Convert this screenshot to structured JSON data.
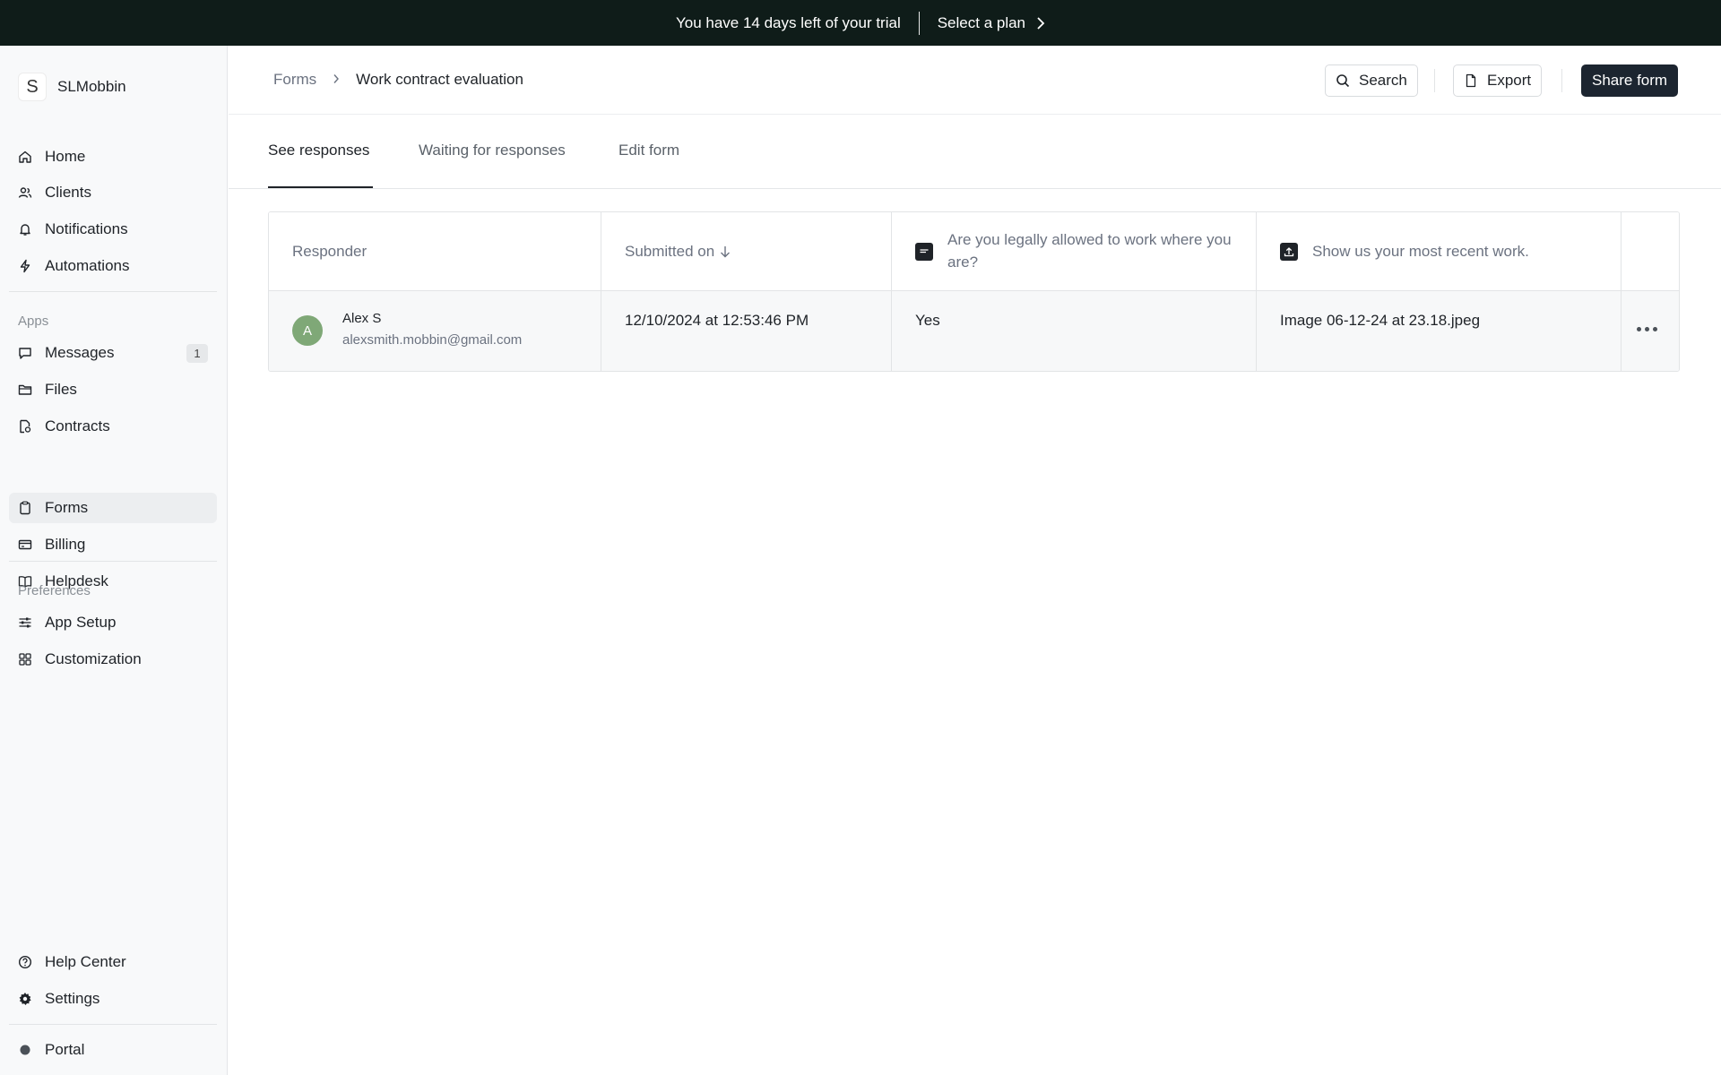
{
  "banner": {
    "trial_text": "You have 14 days left of your trial",
    "cta_label": "Select a plan"
  },
  "sidebar": {
    "brand_initial": "S",
    "brand_name": "SLMobbin",
    "main_items": [
      {
        "label": "Home",
        "icon": "home-icon"
      },
      {
        "label": "Clients",
        "icon": "users-icon"
      },
      {
        "label": "Notifications",
        "icon": "bell-icon"
      },
      {
        "label": "Automations",
        "icon": "bolt-icon"
      }
    ],
    "apps_heading": "Apps",
    "apps_items": [
      {
        "label": "Messages",
        "icon": "message-icon",
        "badge": "1"
      },
      {
        "label": "Files",
        "icon": "folder-icon"
      },
      {
        "label": "Contracts",
        "icon": "contract-icon"
      },
      {
        "label": "Forms",
        "icon": "clipboard-icon",
        "active": true
      },
      {
        "label": "Billing",
        "icon": "credit-card-icon"
      },
      {
        "label": "Helpdesk",
        "icon": "book-icon"
      }
    ],
    "preferences_heading": "Preferences",
    "preferences_items": [
      {
        "label": "App Setup",
        "icon": "sliders-icon"
      },
      {
        "label": "Customization",
        "icon": "grid-icon"
      }
    ],
    "footer_items": [
      {
        "label": "Help Center",
        "icon": "help-icon"
      },
      {
        "label": "Settings",
        "icon": "gear-icon"
      }
    ],
    "portal_label": "Portal"
  },
  "header": {
    "breadcrumb_root": "Forms",
    "breadcrumb_current": "Work contract evaluation",
    "search_label": "Search",
    "export_label": "Export",
    "share_label": "Share form"
  },
  "tabs": [
    {
      "label": "See responses",
      "active": true
    },
    {
      "label": "Waiting for responses"
    },
    {
      "label": "Edit form"
    }
  ],
  "table": {
    "columns": {
      "responder": "Responder",
      "submitted_on": "Submitted on",
      "question_1": "Are you legally allowed to work where you are?",
      "question_2": "Show us your most recent work."
    },
    "rows": [
      {
        "avatar_initial": "A",
        "name": "Alex S",
        "email": "alexsmith.mobbin@gmail.com",
        "submitted_on": "12/10/2024 at 12:53:46 PM",
        "answer_1": "Yes",
        "answer_2": "Image 06-12-24 at 23.18.jpeg"
      }
    ]
  },
  "colors": {
    "banner_bg": "#0f1c19",
    "primary_button": "#1c2530",
    "avatar": "#7fa877",
    "portal_dot": "#4b5158"
  }
}
